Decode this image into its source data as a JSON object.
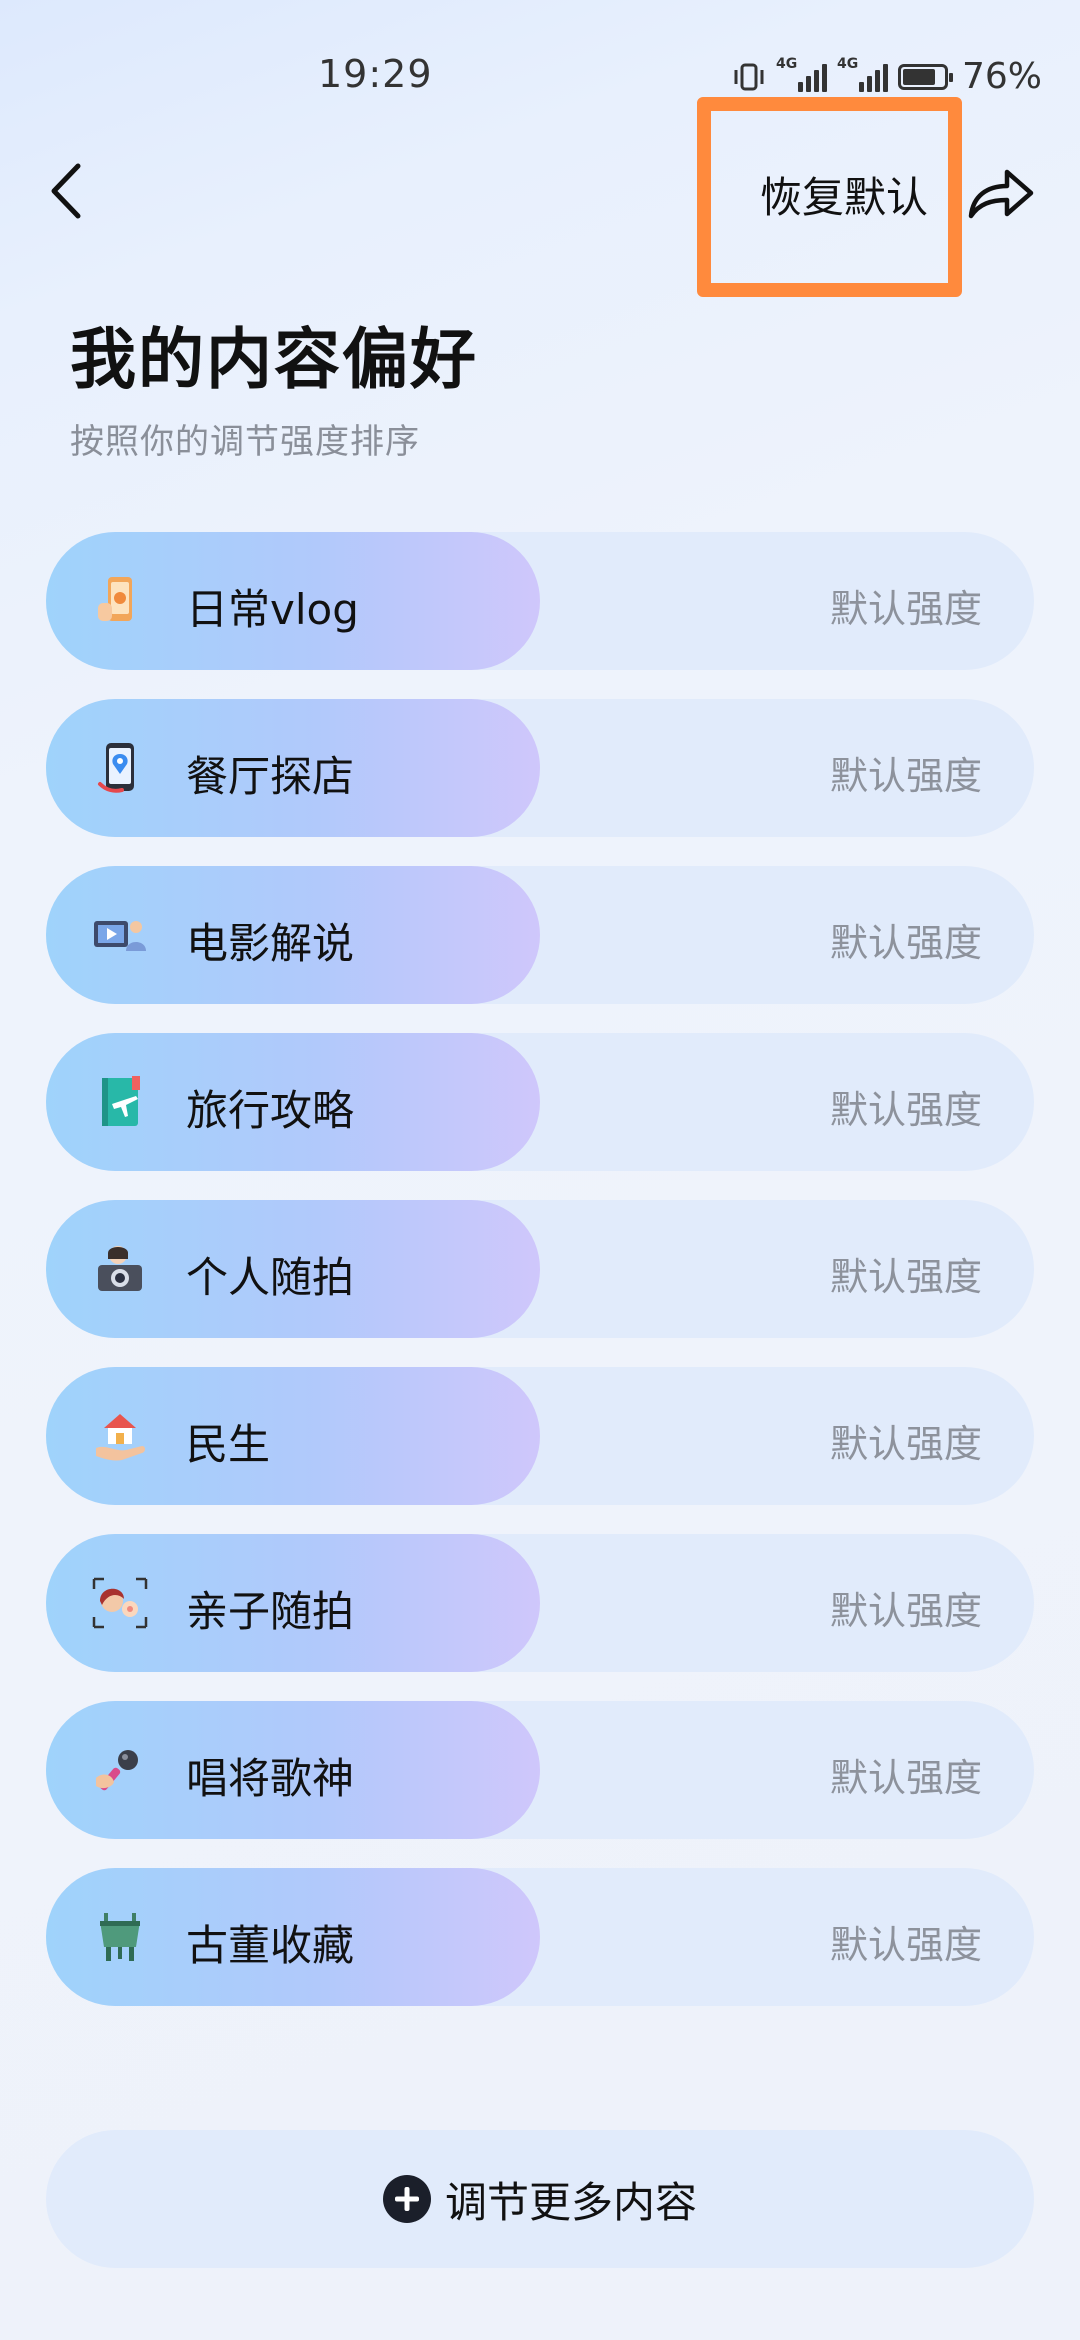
{
  "status_bar": {
    "time": "19:29",
    "network_1": "4G",
    "network_2": "4G",
    "battery": "76%"
  },
  "header": {
    "back_icon": "chevron-left-icon",
    "restore_label": "恢复默认",
    "share_icon": "share-arrow-icon",
    "highlight_color": "#ff8a3d"
  },
  "page": {
    "title": "我的内容偏好",
    "subtitle": "按照你的调节强度排序"
  },
  "preferences": [
    {
      "label": "日常vlog",
      "level": "默认强度",
      "icon": "vlog-phone-icon"
    },
    {
      "label": "餐厅探店",
      "level": "默认强度",
      "icon": "restaurant-map-pin-icon"
    },
    {
      "label": "电影解说",
      "level": "默认强度",
      "icon": "movie-presenter-icon"
    },
    {
      "label": "旅行攻略",
      "level": "默认强度",
      "icon": "travel-guide-book-icon"
    },
    {
      "label": "个人随拍",
      "level": "默认强度",
      "icon": "camera-portrait-icon"
    },
    {
      "label": "民生",
      "level": "默认强度",
      "icon": "house-in-hand-icon"
    },
    {
      "label": "亲子随拍",
      "level": "默认强度",
      "icon": "parent-child-icon"
    },
    {
      "label": "唱将歌神",
      "level": "默认强度",
      "icon": "microphone-icon"
    },
    {
      "label": "古董收藏",
      "level": "默认强度",
      "icon": "bronze-vessel-icon"
    }
  ],
  "footer": {
    "more_label": "调节更多内容",
    "more_icon": "plus-circle-icon"
  }
}
